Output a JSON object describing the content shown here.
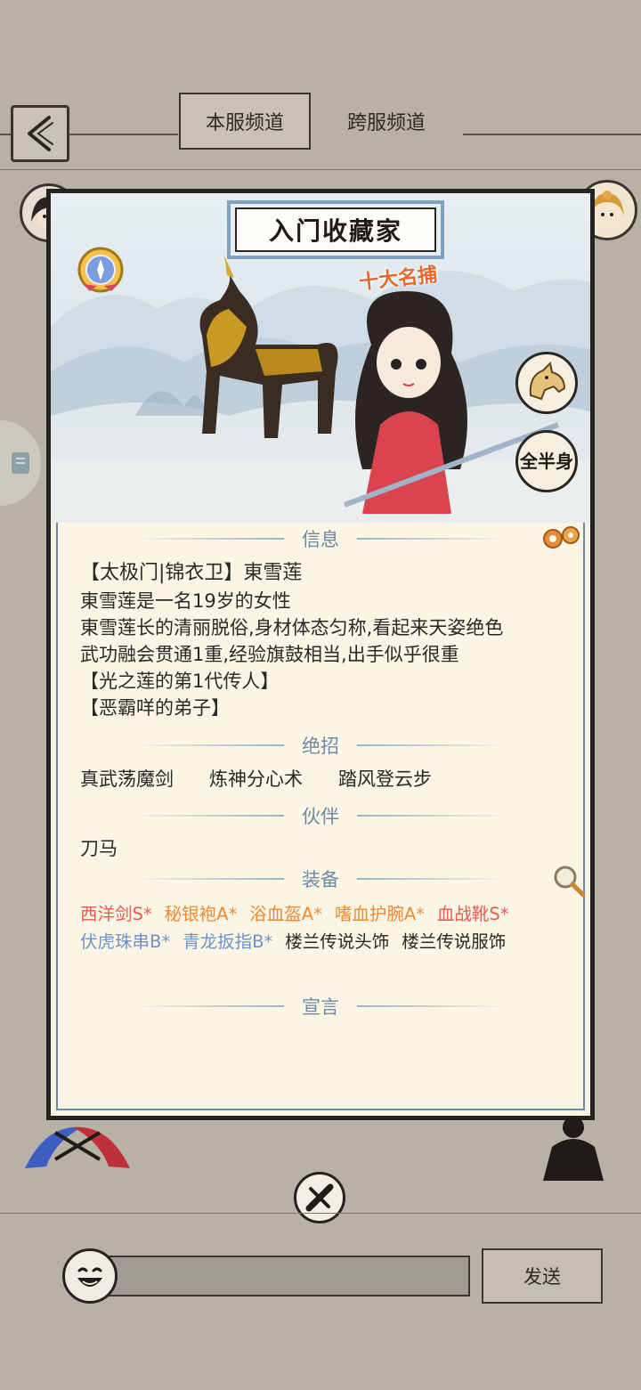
{
  "header": {
    "tabs": [
      {
        "label": "本服频道",
        "active": true
      },
      {
        "label": "跨服频道",
        "active": false
      }
    ]
  },
  "card": {
    "title": "入门收藏家",
    "rank_badge": "十大名捕",
    "view_toggle": "全半身",
    "sections": {
      "info": "信息",
      "skills": "绝招",
      "partner": "伙伴",
      "equipment": "装备",
      "declaration": "宣言"
    },
    "info_lines": [
      "【太极门|锦衣卫】東雪莲",
      "東雪莲是一名19岁的女性",
      "東雪莲长的清丽脱俗,身材体态匀称,看起来天姿绝色",
      "武功融会贯通1重,经验旗鼓相当,出手似乎很重",
      "【光之莲的第1代传人】",
      "【恶霸咩的弟子】"
    ],
    "skills": [
      "真武荡魔剑",
      "炼神分心术",
      "踏风登云步"
    ],
    "partner": "刀马",
    "equipment_row1": [
      {
        "name": "西洋剑S*",
        "color": "#e35d4c"
      },
      {
        "name": "秘银袍A*",
        "color": "#ec8a33"
      },
      {
        "name": "浴血盔A*",
        "color": "#ec8a33"
      },
      {
        "name": "嗜血护腕A*",
        "color": "#ec8a33"
      },
      {
        "name": "血战靴S*",
        "color": "#e35d4c"
      }
    ],
    "equipment_row2": [
      {
        "name": "伏虎珠串B*",
        "color": "#6f92c8"
      },
      {
        "name": "青龙扳指B*",
        "color": "#6f92c8"
      },
      {
        "name": "楼兰传说头饰",
        "color": "#2c2824"
      },
      {
        "name": "楼兰传说服饰",
        "color": "#2c2824"
      }
    ],
    "declaration": ""
  },
  "chat": {
    "input_value": "",
    "input_placeholder": "",
    "send_label": "发送"
  },
  "icons": [
    "back-arrow-icon",
    "magnifier-icon",
    "close-icon",
    "emoji-icon",
    "horse-icon",
    "gear-icon",
    "rank-medal-icon"
  ]
}
